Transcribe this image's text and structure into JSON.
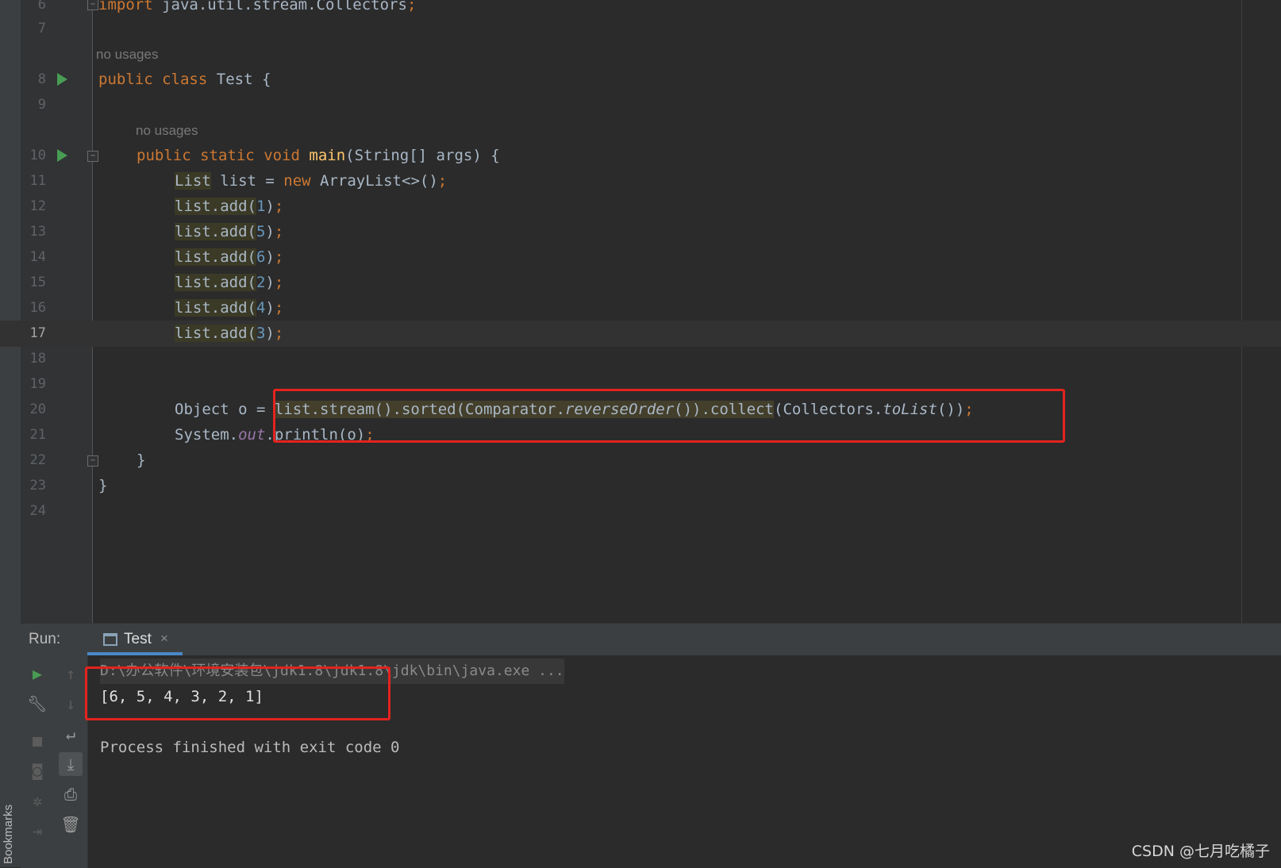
{
  "editor": {
    "hint_no_usages": "no usages",
    "lines": [
      {
        "num": "6",
        "text": "import java.util.stream.Collectors;"
      },
      {
        "num": "7",
        "text": ""
      },
      {
        "num": "8",
        "text": "public class Test {"
      },
      {
        "num": "9",
        "text": ""
      },
      {
        "num": "10",
        "text": "public static void main(String[] args) {"
      },
      {
        "num": "11",
        "text": "List list = new ArrayList<>();"
      },
      {
        "num": "12",
        "text": "list.add(1);"
      },
      {
        "num": "13",
        "text": "list.add(5);"
      },
      {
        "num": "14",
        "text": "list.add(6);"
      },
      {
        "num": "15",
        "text": "list.add(2);"
      },
      {
        "num": "16",
        "text": "list.add(4);"
      },
      {
        "num": "17",
        "text": "list.add(3);"
      },
      {
        "num": "18",
        "text": ""
      },
      {
        "num": "19",
        "text": ""
      },
      {
        "num": "20",
        "text": "Object o = list.stream().sorted(Comparator.reverseOrder()).collect(Collectors.toList());"
      },
      {
        "num": "21",
        "text": "System.out.println(o);"
      },
      {
        "num": "22",
        "text": "}"
      },
      {
        "num": "23",
        "text": "}"
      },
      {
        "num": "24",
        "text": ""
      }
    ],
    "tokens": {
      "import_kw": "import",
      "import_path": " java.util.stream.Collectors",
      "semi": ";",
      "public": "public",
      "class": "class",
      "static": "static",
      "void": "void",
      "test": "Test {",
      "main": "main",
      "main_args": "(String[] args) {",
      "list_type": "List",
      "list_decl": " list = ",
      "new": "new",
      "arraylist": " ArrayList<>()",
      "list_ref": "list",
      "add_call": ".add(",
      "close_paren": ")",
      "object_decl": "Object o = ",
      "stream_chain": "list.stream().sorted(Comparator.",
      "reverse_order": "reverseOrder",
      "collect_part": "()).collect",
      "collectors": "(Collectors.",
      "to_list": "toList",
      "end_call": "())",
      "system": "System.",
      "out": "out",
      "println": ".println(o)",
      "brace_close": "}"
    },
    "args": [
      "1",
      "5",
      "6",
      "2",
      "4",
      "3"
    ]
  },
  "run_panel": {
    "label": "Run:",
    "tab_name": "Test",
    "tab_close": "×",
    "console": {
      "command": "D:\\办公软件\\环境安装包\\jdk1.8\\jdk1.8\\jdk\\bin\\java.exe ...",
      "output": "[6, 5, 4, 3, 2, 1]",
      "finished": "Process finished with exit code 0"
    }
  },
  "sidebar": {
    "bookmarks_label": "Bookmarks"
  },
  "watermark": "CSDN @七月吃橘子",
  "icons": [
    "run-icon",
    "wrench-icon",
    "stop-icon",
    "camera-icon",
    "settings-bug-icon",
    "login-icon",
    "up-arrow-icon",
    "down-arrow-icon",
    "soft-wrap-icon",
    "scroll-to-end-icon",
    "print-icon",
    "trash-icon",
    "run-gutter-icon",
    "fold-icon",
    "window-icon",
    "close-icon"
  ],
  "colors": {
    "background": "#2b2b2b",
    "keyword": "#cc7832",
    "method": "#ffc66d",
    "number": "#6897bb",
    "field": "#9876aa",
    "highlight_box": "#e3231f"
  }
}
